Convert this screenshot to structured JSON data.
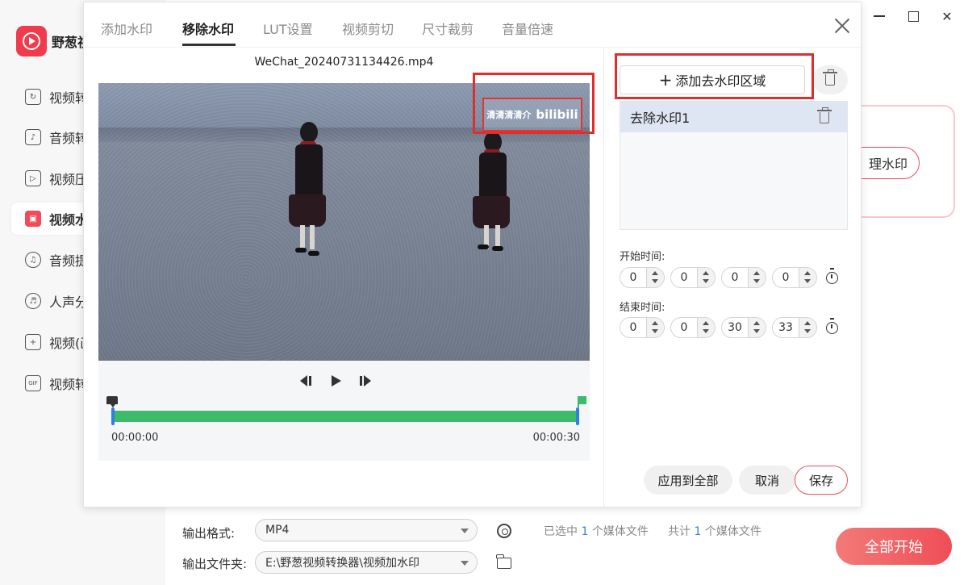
{
  "app": {
    "name": "野葱视",
    "nav": [
      {
        "label": "视频转",
        "icon": "video-convert-icon"
      },
      {
        "label": "音频转",
        "icon": "audio-convert-icon"
      },
      {
        "label": "视频压",
        "icon": "video-compress-icon"
      },
      {
        "label": "视频水",
        "icon": "video-watermark-icon"
      },
      {
        "label": "音频提",
        "icon": "audio-extract-icon"
      },
      {
        "label": "人声分",
        "icon": "voice-separate-icon"
      },
      {
        "label": "视频(画",
        "icon": "video-pip-icon"
      },
      {
        "label": "视频转",
        "icon": "gif-icon"
      }
    ],
    "bg_card_button": "理水印"
  },
  "dialog": {
    "tabs": [
      "添加水印",
      "移除水印",
      "LUT设置",
      "视频剪切",
      "尺寸裁剪",
      "音量倍速"
    ],
    "active_tab": "移除水印",
    "filename": "WeChat_20240731134426.mp4",
    "watermark": {
      "text": "清清清清介",
      "logo": "bilibili"
    },
    "player": {
      "start_time": "00:00:00",
      "end_time": "00:00:30"
    },
    "add_area_label": "添加去水印区域",
    "areas": [
      {
        "label": "去除水印1"
      }
    ],
    "start_label": "开始时间:",
    "end_label": "结束时间:",
    "start_time": [
      "0",
      "0",
      "0",
      "0"
    ],
    "end_time": [
      "0",
      "0",
      "30",
      "33"
    ],
    "apply_all_label": "应用到全部",
    "cancel_label": "取消",
    "save_label": "保存"
  },
  "bottom": {
    "format_label": "输出格式:",
    "format_value": "MP4",
    "folder_label": "输出文件夹:",
    "folder_value": "E:\\野葱视频转换器\\视频加水印",
    "selected_prefix": "已选中",
    "selected_count": "1",
    "selected_suffix": "个媒体文件",
    "total_prefix": "共计",
    "total_count": "1",
    "total_suffix": "个媒体文件",
    "start_all_label": "全部开始"
  },
  "colors": {
    "accent": "#ef4b58",
    "track": "#3dbb6a",
    "handle": "#2f7fe6",
    "highlight": "#e02d2d"
  }
}
